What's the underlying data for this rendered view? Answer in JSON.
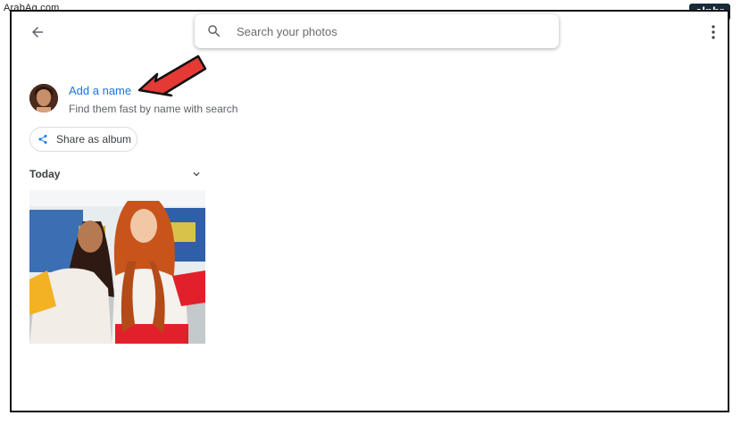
{
  "watermark": "ArabAq.com",
  "brand": "alphr",
  "toolbar": {
    "back_icon": "arrow-back-icon",
    "more_icon": "more-vertical-icon"
  },
  "search": {
    "icon": "search-icon",
    "placeholder": "Search your photos",
    "value": ""
  },
  "person": {
    "add_name_label": "Add a name",
    "subtitle": "Find them fast by name with search"
  },
  "share": {
    "icon": "share-icon",
    "label": "Share as album"
  },
  "section": {
    "label": "Today",
    "chevron_icon": "chevron-down-icon"
  },
  "colors": {
    "accent": "#1a73e8",
    "annotation_arrow": "#e53935"
  }
}
